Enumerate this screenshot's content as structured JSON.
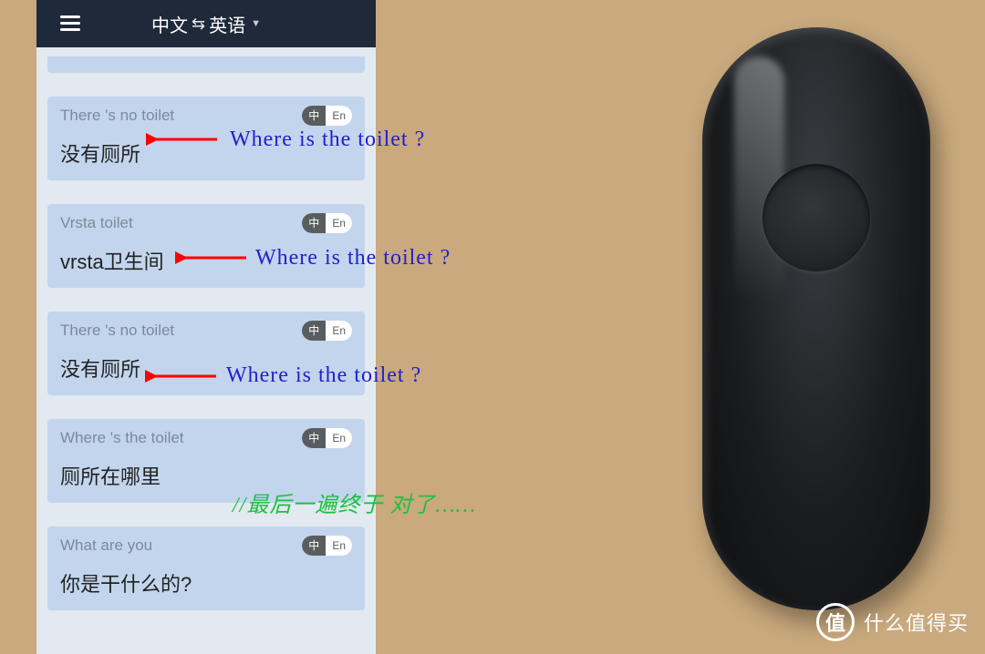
{
  "header": {
    "lang_from": "中文",
    "lang_to": "英语"
  },
  "toggle": {
    "zh": "中",
    "en": "En"
  },
  "cards": [
    {
      "src": "There 's no toilet",
      "trans": "没有厕所"
    },
    {
      "src": "Vrsta toilet",
      "trans": "vrsta卫生间"
    },
    {
      "src": "There 's no toilet",
      "trans": "没有厕所"
    },
    {
      "src": "Where 's the toilet",
      "trans": "厕所在哪里"
    },
    {
      "src": "What are you",
      "trans": "你是干什么的?"
    }
  ],
  "annotations": {
    "q1": "Where is the toilet ?",
    "q2": "Where is the toilet ?",
    "q3": "Where is the toilet ?",
    "comment": "//最后一遍终于   对了……"
  },
  "watermark": {
    "logo_char": "值",
    "text": "什么值得买"
  }
}
